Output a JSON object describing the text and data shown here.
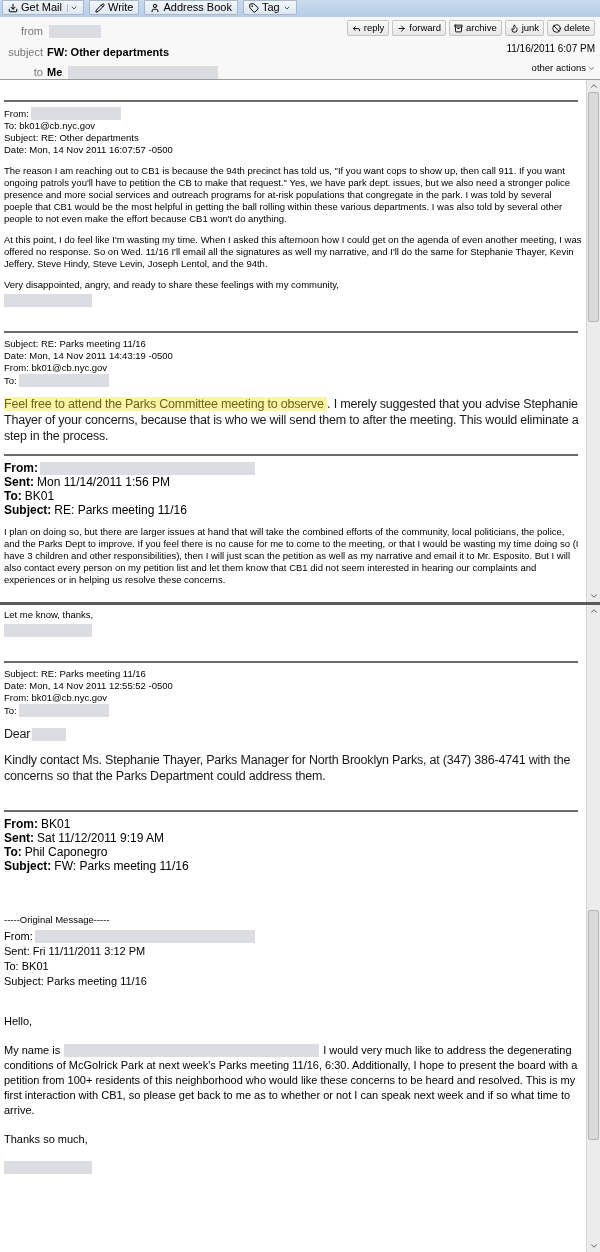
{
  "toolbar": [
    {
      "label": "Get Mail"
    },
    {
      "label": "Write"
    },
    {
      "label": "Address Book"
    },
    {
      "label": "Tag"
    }
  ],
  "header": {
    "from_label": "from",
    "subject_label": "subject",
    "subject": "FW: Other departments",
    "to_label": "to",
    "to": "Me",
    "date": "11/16/2011 6:07 PM",
    "other_actions": "other actions",
    "actions": [
      {
        "label": "reply"
      },
      {
        "label": "forward"
      },
      {
        "label": "archive"
      },
      {
        "label": "junk"
      },
      {
        "label": "delete"
      }
    ]
  },
  "panels": [
    {
      "blocks": [
        {
          "kind": "blank"
        },
        {
          "kind": "rule"
        },
        {
          "kind": "headers",
          "lines": [
            {
              "label": "From:",
              "kind": "redacted"
            },
            {
              "label": "To:",
              "value": "bk01@cb.nyc.gov"
            },
            {
              "label": "Subject:",
              "value": "RE: Other departments"
            },
            {
              "label": "Date:",
              "value": "Mon, 14 Nov 2011 16:07:57 -0500"
            }
          ]
        },
        {
          "kind": "para",
          "segments": [
            {
              "kind": "text",
              "text": "The reason I am reaching out to CB1 is because the 94th precinct has told us, \"If you want cops to show up, then call 911. If you want ongoing patrols you'll have to petition the CB to make that request.\" Yes, we have park dept. issues, but we also need a stronger police presence and more social services and outreach programs for at-risk populations that congregate in the park.  I was told by several poeple that CB1 would be the most helpful in getting the ball rolling within these various departments.  I was also told by several other people to not even make the effort because CB1 won't do anything."
            }
          ]
        },
        {
          "kind": "para",
          "segments": [
            {
              "kind": "text",
              "text": "At this point, I do feel like I'm wasting my time.  When I asked this afternoon how I could get on the agenda of even another meeting, I was offered no response.  So on Wed. 11/16 I'll email all the signatures as well my narrative, and I'll do the same for Stephanie Thayer, Kevin Jeffery, Steve Hindy, Steve Levin,  Joseph Lentol, and the 94th."
            }
          ]
        },
        {
          "kind": "closing",
          "segments": [
            {
              "kind": "text",
              "text": "Very disappointed, angry, and ready to share these feelings with my community,"
            }
          ]
        },
        {
          "kind": "signature"
        },
        {
          "kind": "blank"
        },
        {
          "kind": "rule"
        },
        {
          "kind": "headers",
          "lines": [
            {
              "label": "Subject:",
              "value": "RE: Parks meeting 11/16"
            },
            {
              "label": "Date:",
              "value": "Mon, 14 Nov 2011 14:43:19 -0500"
            },
            {
              "label": "From:",
              "value": "bk01@cb.nyc.gov"
            },
            {
              "label": "To:",
              "kind": "redacted"
            }
          ]
        },
        {
          "kind": "htmlpara",
          "segments": [
            {
              "kind": "highlight",
              "text": "Feel free to attend the Parks Committee meeting to observe "
            },
            {
              "kind": "text",
              "text": ". I merely suggested that you advise Stephanie Thayer of your concerns, because that is who we will send them to after the meeting. This would eliminate a step in the process."
            }
          ]
        },
        {
          "kind": "rule"
        },
        {
          "kind": "boldheaders",
          "lines": [
            {
              "label": "From:",
              "kind": "redacted"
            },
            {
              "label": "Sent:",
              "value": "Mon 11/14/2011 1:56 PM"
            },
            {
              "label": "To:",
              "value": "BK01"
            },
            {
              "label": "Subject:",
              "value": "RE: Parks meeting 11/16"
            }
          ]
        },
        {
          "kind": "para",
          "segments": [
            {
              "kind": "text",
              "text": "I plan on doing so, but there are larger issues at hand that will take the combined efforts of the community, local politicians, the police, and the Parks Dept to improve.  If you feel there is no cause for me to come to the meeting, or that I would be wasting my time doing so (I have 3 children and other responsibilities), then I will just scan the petition as well as my narrative and email it to Mr. Esposito.  But I will also contact every person on my petition list and let them know that CB1 did not seem interested in hearing our complaints and experiences or in helping us resolve these concerns."
            }
          ]
        }
      ]
    },
    {
      "blocks": [
        {
          "kind": "closing",
          "segments": [
            {
              "kind": "text",
              "text": "Let me know, thanks,"
            }
          ]
        },
        {
          "kind": "signature"
        },
        {
          "kind": "blank"
        },
        {
          "kind": "rule"
        },
        {
          "kind": "headers",
          "lines": [
            {
              "label": "Subject:",
              "value": "RE: Parks meeting 11/16"
            },
            {
              "label": "Date:",
              "value": "Mon, 14 Nov 2011 12:55:52 -0500"
            },
            {
              "label": "From:",
              "value": "bk01@cb.nyc.gov"
            },
            {
              "label": "To:",
              "kind": "redacted"
            }
          ]
        },
        {
          "kind": "htmlpara",
          "segments": [
            {
              "kind": "text",
              "text": "Dear"
            },
            {
              "kind": "redacted"
            }
          ]
        },
        {
          "kind": "htmlpara",
          "segments": [
            {
              "kind": "text",
              "text": "Kindly contact Ms. Stephanie Thayer, Parks Manager for North Brooklyn Parks, at (347) 386-4741 with the concerns so that the Parks Department could address them."
            }
          ]
        },
        {
          "kind": "blank"
        },
        {
          "kind": "rule"
        },
        {
          "kind": "boldheaders",
          "lines": [
            {
              "label": "From:",
              "value": "BK01"
            },
            {
              "label": "Sent:",
              "value": "Sat 11/12/2011 9:19 AM"
            },
            {
              "label": "To:",
              "value": "Phil Caponegro"
            },
            {
              "label": "Subject:",
              "value": "FW: Parks meeting 11/16"
            }
          ]
        },
        {
          "kind": "blank"
        },
        {
          "kind": "blank"
        },
        {
          "kind": "closing",
          "segments": [
            {
              "kind": "text",
              "text": "-----Original Message-----"
            }
          ]
        },
        {
          "kind": "plainheaders",
          "lines": [
            {
              "label": "From:",
              "kind": "redacted"
            },
            {
              "label": "Sent:",
              "value": "Fri 11/11/2011 3:12 PM"
            },
            {
              "label": "To:",
              "value": "BK01"
            },
            {
              "label": "Subject:",
              "value": "Parks meeting 11/16"
            }
          ]
        },
        {
          "kind": "blank"
        },
        {
          "kind": "letterpara",
          "segments": [
            {
              "kind": "text",
              "text": "Hello,"
            }
          ]
        },
        {
          "kind": "letterline",
          "segments": [
            {
              "kind": "text",
              "text": "My name is"
            },
            {
              "kind": "redacted"
            },
            {
              "kind": "text",
              "text": "I would very much like to address the degenerating"
            }
          ]
        },
        {
          "kind": "letterpara",
          "segments": [
            {
              "kind": "text",
              "text": "conditions of McGolrick Park at next week's Parks meeting 11/16, 6:30.  Additionally, I hope to present the board with a petition from 100+ residents of this neighborhood who would like these concerns to be heard and resolved.  This is my first interaction with CB1, so please get back to me as to whether or not I can speak next week and if so what time to arrive."
            }
          ]
        },
        {
          "kind": "letterpara",
          "segments": [
            {
              "kind": "text",
              "text": "Thanks so much,"
            }
          ]
        },
        {
          "kind": "signature"
        }
      ]
    }
  ]
}
